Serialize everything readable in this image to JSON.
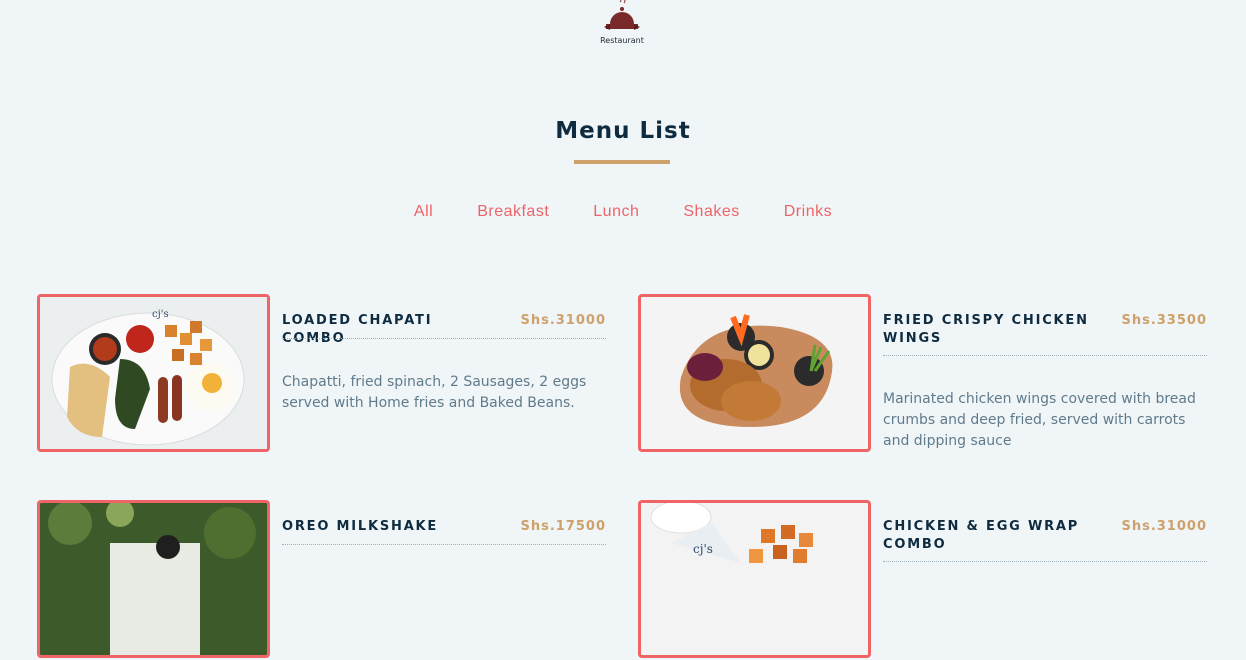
{
  "brand": {
    "logo_text": "Restaurant",
    "icon": "cloche-icon"
  },
  "section": {
    "title": "Menu List"
  },
  "filters": [
    "All",
    "Breakfast",
    "Lunch",
    "Shakes",
    "Drinks"
  ],
  "colors": {
    "accent": "#ee6467",
    "gold": "#cea16a",
    "navy": "#0e2b40",
    "text": "#607b8b",
    "background": "#f0f5f8"
  },
  "items": [
    {
      "name": "LOADED CHAPATI COMBO",
      "price": "Shs.31000",
      "description": "Chapatti, fried spinach, 2 Sausages, 2 eggs served with Home fries and Baked Beans.",
      "image": "breakfast-plate-photo"
    },
    {
      "name": "FRIED CRISPY CHICKEN WINGS",
      "price": "Shs.33500",
      "description": "Marinated chicken wings covered with bread crumbs and deep fried, served with carrots and dipping sauce",
      "image": "chicken-wings-photo"
    },
    {
      "name": "OREO MILKSHAKE",
      "price": "Shs.17500",
      "description": "",
      "image": "oreo-milkshake-photo"
    },
    {
      "name": "CHICKEN & EGG WRAP COMBO",
      "price": "Shs.31000",
      "description": "",
      "image": "wrap-combo-photo"
    }
  ]
}
